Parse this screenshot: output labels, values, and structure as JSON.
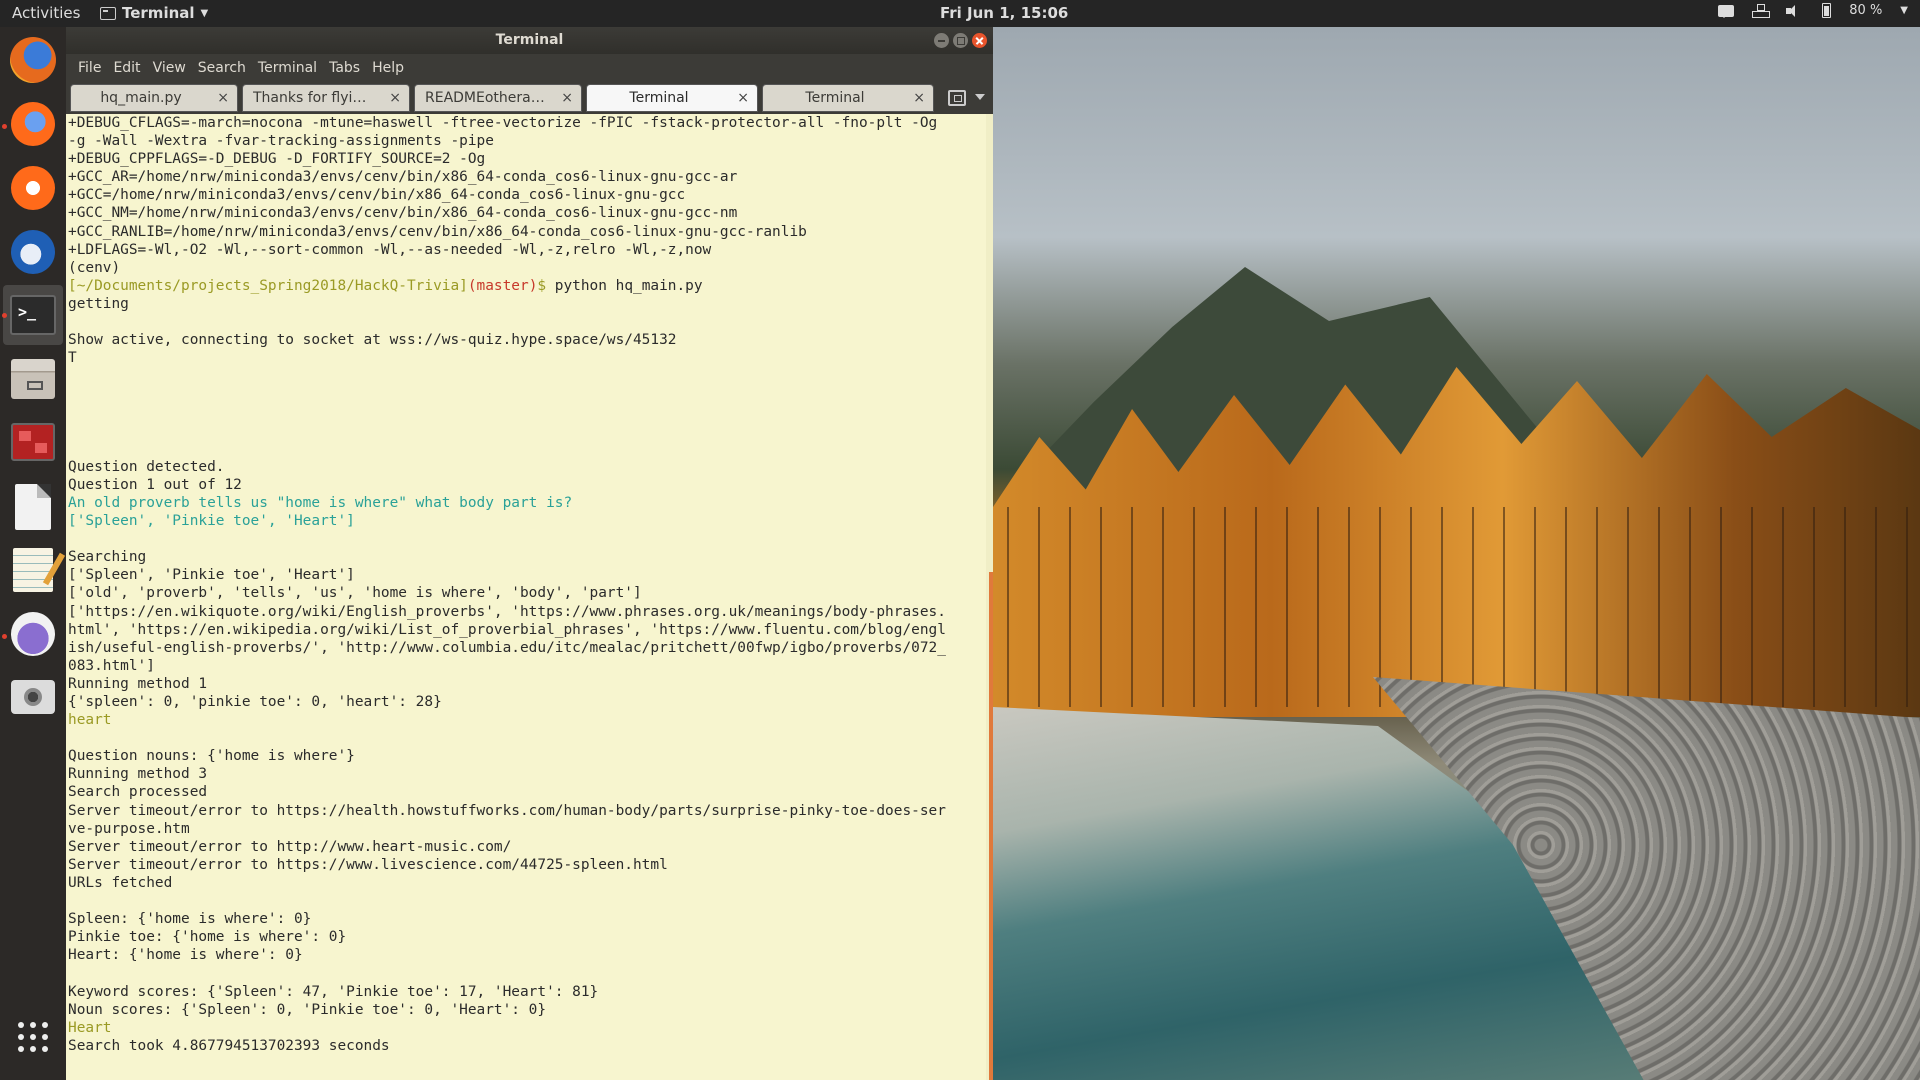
{
  "top_panel": {
    "activities": "Activities",
    "app_name": "Terminal",
    "clock": "Fri Jun  1, 15:06",
    "battery": "80 %"
  },
  "dock": {
    "items": [
      "firefox",
      "firefox-dev",
      "firefox-nightly",
      "thunderbird",
      "terminal",
      "files",
      "app-red",
      "libreoffice-doc",
      "text-editor",
      "pidgin",
      "screenshot",
      "show-apps"
    ]
  },
  "window": {
    "title": "Terminal",
    "menu": [
      "File",
      "Edit",
      "View",
      "Search",
      "Terminal",
      "Tabs",
      "Help"
    ],
    "tabs": [
      {
        "label": "hq_main.py",
        "close": "×"
      },
      {
        "label": "Thanks for flying ...",
        "close": "×"
      },
      {
        "label": "READMEotherap...",
        "close": "×"
      },
      {
        "label": "Terminal",
        "close": "×"
      },
      {
        "label": "Terminal",
        "close": "×"
      }
    ]
  },
  "terminal": {
    "lines": [
      {
        "t": "+DEBUG_CFLAGS=-march=nocona -mtune=haswell -ftree-vectorize -fPIC -fstack-protector-all -fno-plt -Og"
      },
      {
        "t": "-g -Wall -Wextra -fvar-tracking-assignments -pipe"
      },
      {
        "t": "+DEBUG_CPPFLAGS=-D_DEBUG -D_FORTIFY_SOURCE=2 -Og"
      },
      {
        "t": "+GCC_AR=/home/nrw/miniconda3/envs/cenv/bin/x86_64-conda_cos6-linux-gnu-gcc-ar"
      },
      {
        "t": "+GCC=/home/nrw/miniconda3/envs/cenv/bin/x86_64-conda_cos6-linux-gnu-gcc"
      },
      {
        "t": "+GCC_NM=/home/nrw/miniconda3/envs/cenv/bin/x86_64-conda_cos6-linux-gnu-gcc-nm"
      },
      {
        "t": "+GCC_RANLIB=/home/nrw/miniconda3/envs/cenv/bin/x86_64-conda_cos6-linux-gnu-gcc-ranlib"
      },
      {
        "t": "+LDFLAGS=-Wl,-O2 -Wl,--sort-common -Wl,--as-needed -Wl,-z,relro -Wl,-z,now"
      },
      {
        "t": "(cenv)"
      },
      {
        "prompt": true,
        "path": "[~/Documents/projects_Spring2018/HackQ-Trivia]",
        "branch": "(master)",
        "sym": "$",
        "cmd": " python hq_main.py"
      },
      {
        "t": "getting"
      },
      {
        "t": ""
      },
      {
        "t": "Show active, connecting to socket at wss://ws-quiz.hype.space/ws/45132"
      },
      {
        "t": "T"
      },
      {
        "t": ""
      },
      {
        "t": ""
      },
      {
        "t": ""
      },
      {
        "t": ""
      },
      {
        "t": ""
      },
      {
        "t": "Question detected."
      },
      {
        "t": "Question 1 out of 12"
      },
      {
        "t": "An old proverb tells us \"home is where\" what body part is?",
        "c": "teal"
      },
      {
        "t": "['Spleen', 'Pinkie toe', 'Heart']",
        "c": "teal"
      },
      {
        "t": ""
      },
      {
        "t": "Searching"
      },
      {
        "t": "['Spleen', 'Pinkie toe', 'Heart']"
      },
      {
        "t": "['old', 'proverb', 'tells', 'us', 'home is where', 'body', 'part']"
      },
      {
        "t": "['https://en.wikiquote.org/wiki/English_proverbs', 'https://www.phrases.org.uk/meanings/body-phrases."
      },
      {
        "t": "html', 'https://en.wikipedia.org/wiki/List_of_proverbial_phrases', 'https://www.fluentu.com/blog/engl"
      },
      {
        "t": "ish/useful-english-proverbs/', 'http://www.columbia.edu/itc/mealac/pritchett/00fwp/igbo/proverbs/072_"
      },
      {
        "t": "083.html']"
      },
      {
        "t": "Running method 1"
      },
      {
        "t": "{'spleen': 0, 'pinkie toe': 0, 'heart': 28}"
      },
      {
        "t": "heart",
        "c": "olive"
      },
      {
        "t": ""
      },
      {
        "t": "Question nouns: {'home is where'}"
      },
      {
        "t": "Running method 3"
      },
      {
        "t": "Search processed"
      },
      {
        "t": "Server timeout/error to https://health.howstuffworks.com/human-body/parts/surprise-pinky-toe-does-ser"
      },
      {
        "t": "ve-purpose.htm"
      },
      {
        "t": "Server timeout/error to http://www.heart-music.com/"
      },
      {
        "t": "Server timeout/error to https://www.livescience.com/44725-spleen.html"
      },
      {
        "t": "URLs fetched"
      },
      {
        "t": ""
      },
      {
        "t": "Spleen: {'home is where': 0}"
      },
      {
        "t": "Pinkie toe: {'home is where': 0}"
      },
      {
        "t": "Heart: {'home is where': 0}"
      },
      {
        "t": ""
      },
      {
        "t": "Keyword scores: {'Spleen': 47, 'Pinkie toe': 17, 'Heart': 81}"
      },
      {
        "t": "Noun scores: {'Spleen': 0, 'Pinkie toe': 0, 'Heart': 0}"
      },
      {
        "t": "Heart",
        "c": "olive"
      },
      {
        "t": "Search took 4.867794513702393 seconds"
      }
    ]
  },
  "colors": {
    "terminal_bg": "#f7f5cf",
    "terminal_fg": "#2b2b2b",
    "teal": "#2aa198",
    "olive": "#9a9a24",
    "prompt_red": "#c7392b",
    "close_button": "#e8542c",
    "scroll_thumb": "#e0793b"
  }
}
